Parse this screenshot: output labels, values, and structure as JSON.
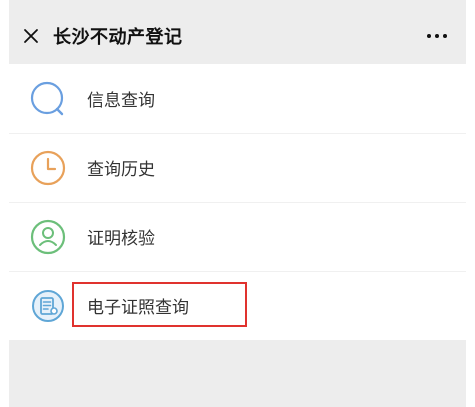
{
  "header": {
    "title": "长沙不动产登记",
    "close_icon": "close-icon",
    "more_icon": "more-dots-icon"
  },
  "menu": {
    "items": [
      {
        "label": "信息查询",
        "icon": "search-icon",
        "color": "#6a9fe0"
      },
      {
        "label": "查询历史",
        "icon": "clock-icon",
        "color": "#e8a15a"
      },
      {
        "label": "证明核验",
        "icon": "person-icon",
        "color": "#6cbf7a"
      },
      {
        "label": "电子证照查询",
        "icon": "document-icon",
        "color": "#5fa6d6",
        "highlighted": true
      }
    ]
  },
  "colors": {
    "background": "#ededed",
    "card": "#ffffff",
    "highlight": "#e0322e"
  }
}
